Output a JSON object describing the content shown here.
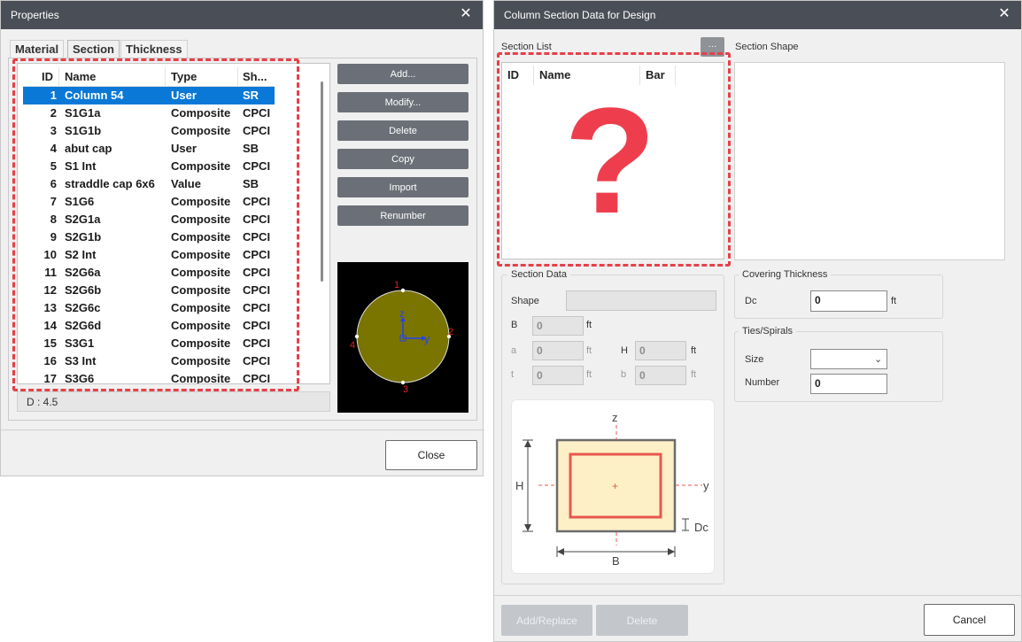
{
  "properties": {
    "title": "Properties",
    "tabs": [
      "Material",
      "Section",
      "Thickness"
    ],
    "columns": [
      "ID",
      "Name",
      "Type",
      "Sh..."
    ],
    "rows": [
      {
        "id": "1",
        "name": "Column 54",
        "type": "User",
        "shape": "SR"
      },
      {
        "id": "2",
        "name": "S1G1a",
        "type": "Composite",
        "shape": "CPCI"
      },
      {
        "id": "3",
        "name": "S1G1b",
        "type": "Composite",
        "shape": "CPCI"
      },
      {
        "id": "4",
        "name": "abut cap",
        "type": "User",
        "shape": "SB"
      },
      {
        "id": "5",
        "name": "S1 Int",
        "type": "Composite",
        "shape": "CPCI"
      },
      {
        "id": "6",
        "name": "straddle cap 6x6",
        "type": "Value",
        "shape": "SB"
      },
      {
        "id": "7",
        "name": "S1G6",
        "type": "Composite",
        "shape": "CPCI"
      },
      {
        "id": "8",
        "name": "S2G1a",
        "type": "Composite",
        "shape": "CPCI"
      },
      {
        "id": "9",
        "name": "S2G1b",
        "type": "Composite",
        "shape": "CPCI"
      },
      {
        "id": "10",
        "name": "S2 Int",
        "type": "Composite",
        "shape": "CPCI"
      },
      {
        "id": "11",
        "name": "S2G6a",
        "type": "Composite",
        "shape": "CPCI"
      },
      {
        "id": "12",
        "name": "S2G6b",
        "type": "Composite",
        "shape": "CPCI"
      },
      {
        "id": "13",
        "name": "S2G6c",
        "type": "Composite",
        "shape": "CPCI"
      },
      {
        "id": "14",
        "name": "S2G6d",
        "type": "Composite",
        "shape": "CPCI"
      },
      {
        "id": "15",
        "name": "S3G1",
        "type": "Composite",
        "shape": "CPCI"
      },
      {
        "id": "16",
        "name": "S3 Int",
        "type": "Composite",
        "shape": "CPCI"
      },
      {
        "id": "17",
        "name": "S3G6",
        "type": "Composite",
        "shape": "CPCI"
      }
    ],
    "buttons": {
      "add": "Add...",
      "modify": "Modify...",
      "delete": "Delete",
      "copy": "Copy",
      "import": "Import",
      "renumber": "Renumber"
    },
    "status": "D : 4.5",
    "close_label": "Close",
    "preview": {
      "z": "z",
      "y": "y",
      "p1": "1",
      "p2": "2",
      "p3": "3",
      "p4": "4"
    }
  },
  "design": {
    "title": "Column Section Data for Design",
    "section_list_label": "Section List",
    "section_list_columns": [
      "ID",
      "Name",
      "Bar"
    ],
    "placeholder_mark": "?",
    "section_shape_label": "Section Shape",
    "section_data_label": "Section Data",
    "shape_label": "Shape",
    "fields": {
      "B": {
        "label": "B",
        "value": "0",
        "unit": "ft"
      },
      "a": {
        "label": "a",
        "value": "0",
        "unit": "ft"
      },
      "H": {
        "label": "H",
        "value": "0",
        "unit": "ft"
      },
      "t": {
        "label": "t",
        "value": "0",
        "unit": "ft"
      },
      "b": {
        "label": "b",
        "value": "0",
        "unit": "ft"
      }
    },
    "covering_label": "Covering Thickness",
    "dc_label": "Dc",
    "dc_value": "0",
    "dc_unit": "ft",
    "ties_label": "Ties/Spirals",
    "size_label": "Size",
    "size_value": "",
    "number_label": "Number",
    "number_value": "0",
    "diagram": {
      "z": "z",
      "y": "y",
      "H": "H",
      "B": "B",
      "Dc": "Dc",
      "plus": "+"
    },
    "add_replace_label": "Add/Replace",
    "delete_label": "Delete",
    "cancel_label": "Cancel"
  },
  "colors": {
    "titlebar": "#4a4f57",
    "selected_row": "#0a78d7",
    "highlight": "#e6404a",
    "section_fill": "#7a7400",
    "section_rect_fill": "#fdf0c6",
    "rebar_rect": "#e8574e"
  }
}
